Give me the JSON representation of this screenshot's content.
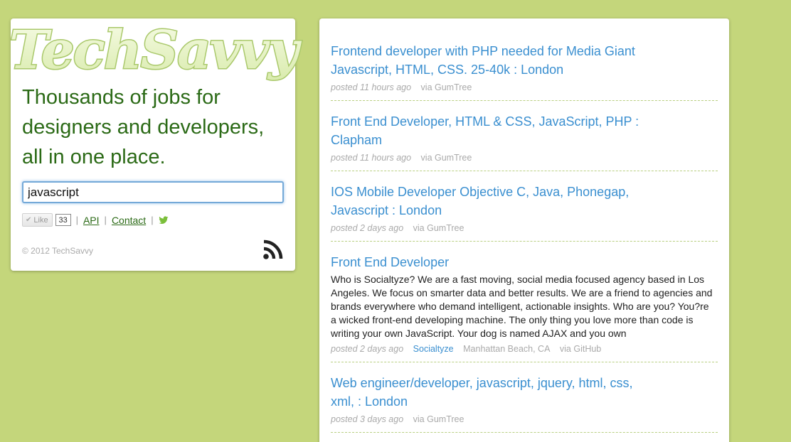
{
  "brand": {
    "logo_text": "TechSavvy"
  },
  "tagline": "Thousands of jobs for designers and developers, all in one place.",
  "search": {
    "value": "javascript"
  },
  "social": {
    "like_label": "Like",
    "like_count": "33",
    "api_label": "API",
    "contact_label": "Contact"
  },
  "footer": {
    "copyright": "© 2012 TechSavvy"
  },
  "colors": {
    "background": "#c4d67b",
    "tagline": "#2b6a16",
    "link": "#3a8fd0",
    "muted": "#aaaaaa"
  },
  "jobs": [
    {
      "title": "Frontend developer with PHP needed for Media Giant Javascript, HTML, CSS. 25-40k : London",
      "time": "posted 11 hours ago",
      "source": "via GumTree"
    },
    {
      "title": "Front End Developer, HTML & CSS, JavaScript, PHP : Clapham",
      "time": "posted 11 hours ago",
      "source": "via GumTree"
    },
    {
      "title": "IOS Mobile Developer Objective C, Java, Phonegap, Javascript : London",
      "time": "posted 2 days ago",
      "source": "via GumTree"
    },
    {
      "title": "Front End Developer",
      "description": "Who is Socialtyze? We are a fast moving, social media focused agency based in Los Angeles. We focus on smarter data and better results. We are a friend to agencies and brands everywhere who demand intelligent, actionable insights. Who are you? You?re a wicked front-end developing machine. The only thing you love more than code is writing your own JavaScript. Your dog is named AJAX and you own",
      "time": "posted 2 days ago",
      "company": "Socialtyze",
      "location": "Manhattan Beach, CA",
      "source": "via GitHub"
    },
    {
      "title": "Web engineer/developer, javascript, jquery, html, css, xml, : London",
      "time": "posted 3 days ago",
      "source": "via GumTree"
    }
  ]
}
